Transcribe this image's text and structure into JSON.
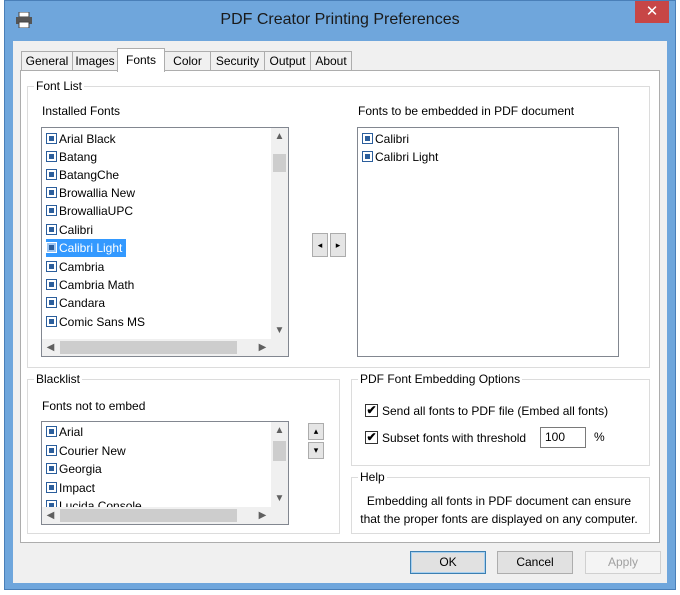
{
  "window": {
    "title": "PDF Creator Printing Preferences",
    "close_glyph": "✕"
  },
  "tabs": [
    {
      "label": "General"
    },
    {
      "label": "Images"
    },
    {
      "label": "Fonts",
      "active": true
    },
    {
      "label": "Color"
    },
    {
      "label": "Security"
    },
    {
      "label": "Output"
    },
    {
      "label": "About"
    }
  ],
  "font_list": {
    "legend": "Font List",
    "installed_label": "Installed Fonts",
    "installed": [
      "Arial Black",
      "Batang",
      "BatangChe",
      "Browallia New",
      "BrowalliaUPC",
      "Calibri",
      "Calibri Light",
      "Cambria",
      "Cambria Math",
      "Candara",
      "Comic Sans MS"
    ],
    "selected_installed": "Calibri Light",
    "embedded_label": "Fonts to be embedded in PDF document",
    "embedded": [
      "Calibri",
      "Calibri Light"
    ],
    "move_left_glyph": "◂",
    "move_right_glyph": "▸"
  },
  "blacklist": {
    "legend": "Blacklist",
    "label": "Fonts not to embed",
    "items": [
      "Arial",
      "Courier New",
      "Georgia",
      "Impact",
      "Lucida Console"
    ],
    "up_glyph": "▴",
    "down_glyph": "▾"
  },
  "embedding_options": {
    "legend": "PDF Font Embedding Options",
    "send_all_label": "Send all fonts to PDF file (Embed all fonts)",
    "send_all_checked": true,
    "subset_label": "Subset fonts with threshold",
    "subset_checked": true,
    "threshold_value": "100",
    "threshold_unit": "%"
  },
  "help": {
    "legend": "Help",
    "text": "Embedding all fonts in PDF document can ensure that the proper fonts are displayed on any computer."
  },
  "buttons": {
    "ok": "OK",
    "cancel": "Cancel",
    "apply": "Apply"
  },
  "icons": {
    "app": "printer-icon",
    "font_item": "font-file-icon",
    "scroll_up": "▲",
    "scroll_down": "▼",
    "scroll_left": "◀",
    "scroll_right": "▶",
    "check": "✔"
  }
}
